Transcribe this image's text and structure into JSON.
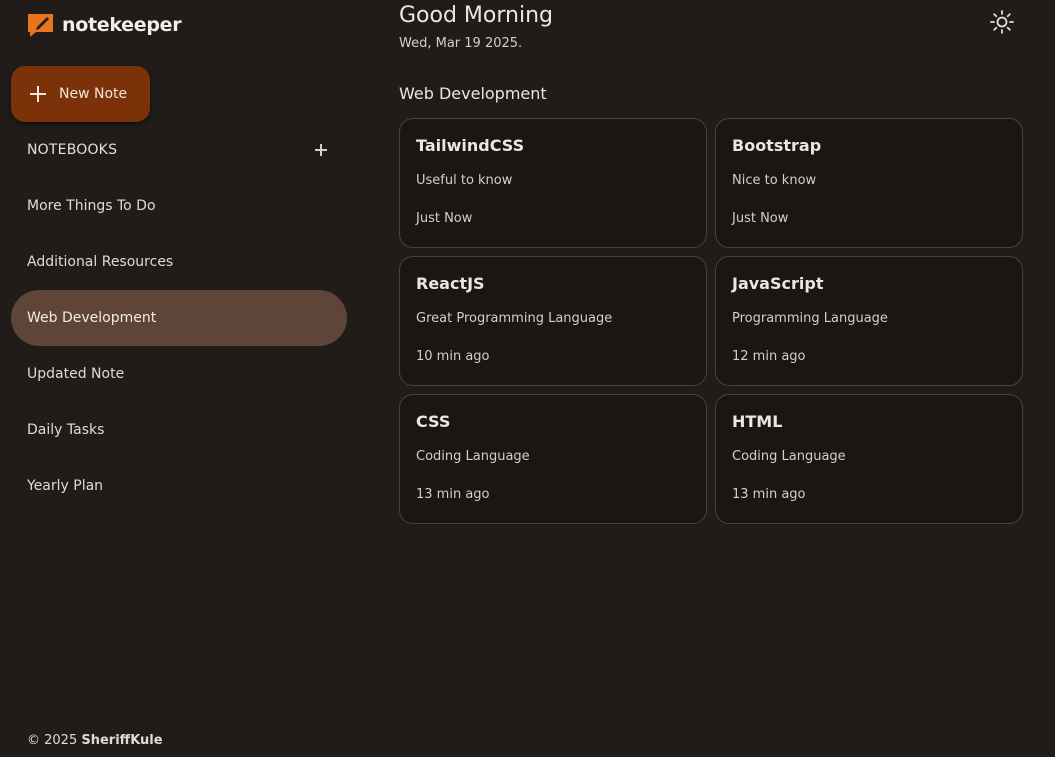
{
  "app": {
    "name": "notekeeper",
    "accent": "#e8741e"
  },
  "sidebar": {
    "new_note_label": "New Note",
    "notebooks_title": "NOTEBOOKS",
    "items": [
      {
        "label": "More Things To Do",
        "active": false
      },
      {
        "label": "Additional Resources",
        "active": false
      },
      {
        "label": "Web Development",
        "active": true
      },
      {
        "label": "Updated Note",
        "active": false
      },
      {
        "label": "Daily Tasks",
        "active": false
      },
      {
        "label": "Yearly Plan",
        "active": false
      }
    ],
    "footer": {
      "prefix": "© 2025",
      "author": "SheriffKule"
    }
  },
  "header": {
    "greeting": "Good Morning",
    "date": "Wed, Mar 19 2025.",
    "theme_icon": "sun-icon"
  },
  "main": {
    "section_title": "Web Development",
    "notes": [
      {
        "title": "TailwindCSS",
        "description": "Useful to know",
        "time": "Just Now"
      },
      {
        "title": "Bootstrap",
        "description": "Nice to know",
        "time": "Just Now"
      },
      {
        "title": "ReactJS",
        "description": "Great Programming Language",
        "time": "10 min ago"
      },
      {
        "title": "JavaScript",
        "description": "Programming Language",
        "time": "12 min ago"
      },
      {
        "title": "CSS",
        "description": "Coding Language",
        "time": "13 min ago"
      },
      {
        "title": "HTML",
        "description": "Coding Language",
        "time": "13 min ago"
      }
    ]
  },
  "colors": {
    "background": "#211c1a",
    "new_note_button": "#7b3208",
    "active_item": "#5e4538",
    "card_border": "#4b423e"
  }
}
